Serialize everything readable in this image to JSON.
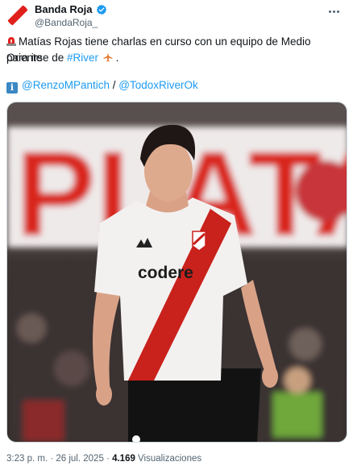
{
  "account": {
    "display_name": "Banda Roja",
    "handle": "@BandaRoja_",
    "verified": true,
    "avatar_icon": "red-diagonal-stripe-logo"
  },
  "tweet": {
    "line1_text": "Matías Rojas tiene charlas en curso con un equipo de Medio Oriente",
    "line2_prefix": "para irse de ",
    "hashtag": "#River",
    "line2_suffix": " .",
    "credits_separator": " / ",
    "credit_1": "@RenzoMPantich",
    "credit_2": "@TodoxRiverOk",
    "emoji_siren": "siren",
    "emoji_plane": "airplane",
    "emoji_info": "i"
  },
  "media": {
    "image_icon": "player-photo",
    "jersey_sponsor": "codere",
    "banner_text": "PLATA"
  },
  "meta": {
    "time": "3:23 p. m.",
    "separator": " · ",
    "date": "26 jul. 2025",
    "views_count": "4.169",
    "views_label": " Visualizaciones"
  },
  "colors": {
    "link": "#1d9bf0",
    "verified": "#1d9bf0",
    "brand_red": "#e0201b",
    "muted": "#536471"
  }
}
